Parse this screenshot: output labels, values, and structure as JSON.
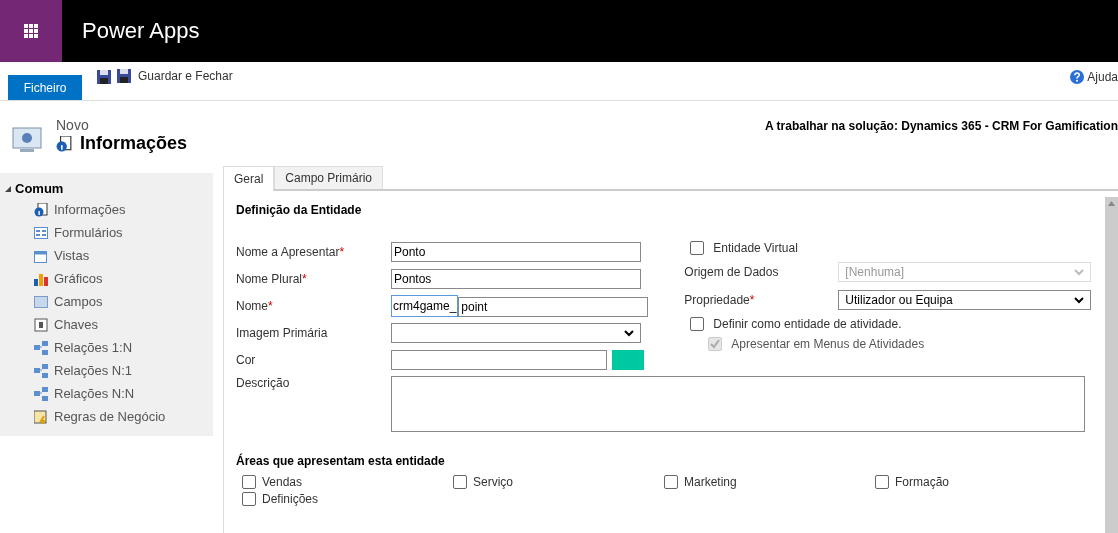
{
  "app": {
    "title": "Power Apps"
  },
  "toolbar": {
    "file_button": "Ficheiro",
    "save_close": "Guardar e Fechar",
    "help": "Ajuda"
  },
  "header": {
    "subtitle": "Novo",
    "title": "Informações",
    "solution": "A trabalhar na solução: Dynamics 365 - CRM For Gamification"
  },
  "sidebar": {
    "group": "Comum",
    "expanded": true,
    "items": [
      {
        "label": "Informações"
      },
      {
        "label": "Formulários"
      },
      {
        "label": "Vistas"
      },
      {
        "label": "Gráficos"
      },
      {
        "label": "Campos"
      },
      {
        "label": "Chaves"
      },
      {
        "label": "Relações 1:N"
      },
      {
        "label": "Relações N:1"
      },
      {
        "label": "Relações N:N"
      },
      {
        "label": "Regras de Negócio"
      }
    ]
  },
  "tabs": [
    {
      "label": "Geral",
      "selected": true
    },
    {
      "label": "Campo Primário",
      "selected": false
    }
  ],
  "section_title": "Definição da Entidade",
  "left_fields": [
    {
      "kind": "text",
      "label": "Nome a Apresentar",
      "required_mark": "*",
      "value": "Ponto"
    },
    {
      "kind": "text",
      "label": "Nome Plural",
      "required_mark": "*",
      "value": "Pontos"
    },
    {
      "kind": "prefixed",
      "label": "Nome",
      "required_mark": "*",
      "prefix": "crm4game_",
      "value": "point"
    },
    {
      "kind": "select",
      "label": "Imagem Primária"
    },
    {
      "kind": "color",
      "label": "Cor",
      "color": "#00c8a0"
    },
    {
      "kind": "textarea",
      "label": "Descrição"
    }
  ],
  "right_fields": [
    {
      "kind": "checkbox",
      "label": "Entidade Virtual",
      "checked": false,
      "disabled": false
    },
    {
      "kind": "select",
      "label": "Origem de Dados",
      "value": "[Nenhuma]",
      "disabled": true
    },
    {
      "kind": "select",
      "label": "Propriedade",
      "value": "Utilizador ou Equipa",
      "required_mark": "*",
      "disabled": false
    },
    {
      "kind": "checkbox",
      "label": "Definir como entidade de atividade.",
      "checked": false,
      "disabled": false,
      "children": [
        {
          "kind": "checkbox",
          "label": "Apresentar em Menus de Atividades",
          "checked": true,
          "disabled": true
        }
      ]
    }
  ],
  "areas": {
    "title": "Áreas que apresentam esta entidade",
    "options": [
      {
        "label": "Vendas",
        "checked": false
      },
      {
        "label": "Serviço",
        "checked": false
      },
      {
        "label": "Marketing",
        "checked": false
      },
      {
        "label": "Formação",
        "checked": false
      },
      {
        "label": "Definições",
        "checked": false
      }
    ]
  }
}
